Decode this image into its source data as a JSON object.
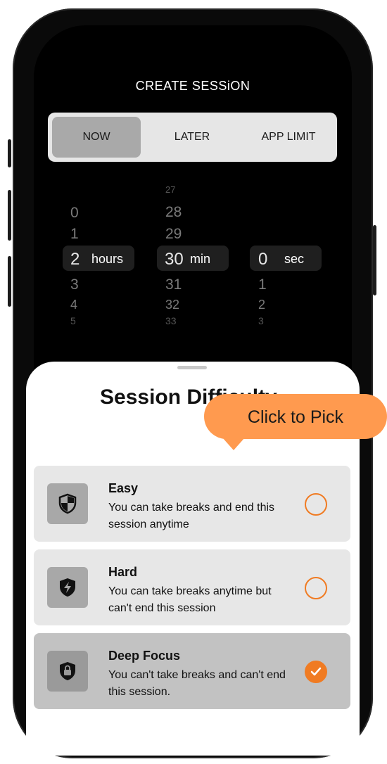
{
  "header": {
    "title": "CREATE SESSiON"
  },
  "tabs": [
    {
      "label": "NOW",
      "active": true
    },
    {
      "label": "LATER",
      "active": false
    },
    {
      "label": "APP LIMIT",
      "active": false
    }
  ],
  "picker": {
    "hours": {
      "selected": "2",
      "unit": "hours",
      "above": [
        "0",
        "1"
      ],
      "below": [
        "3",
        "4",
        "5"
      ]
    },
    "minutes": {
      "selected": "30",
      "unit": "min",
      "above": [
        "27",
        "28",
        "29"
      ],
      "below": [
        "31",
        "32",
        "33"
      ]
    },
    "seconds": {
      "selected": "0",
      "unit": "sec",
      "above": [],
      "below": [
        "1",
        "2",
        "3"
      ]
    }
  },
  "sheet": {
    "title": "Session Difficulty",
    "tooltip": "Click to Pick",
    "options": [
      {
        "title": "Easy",
        "description": "You can take breaks and end this session anytime",
        "icon": "shield-icon",
        "selected": false
      },
      {
        "title": "Hard",
        "description": "You can take breaks anytime but can't end this session",
        "icon": "bolt-shield-icon",
        "selected": false
      },
      {
        "title": "Deep Focus",
        "description": "You can't take breaks and can't end this session.",
        "icon": "lock-shield-icon",
        "selected": true
      }
    ]
  },
  "colors": {
    "accent": "#f07b22",
    "tooltip": "#ff9a4f"
  }
}
